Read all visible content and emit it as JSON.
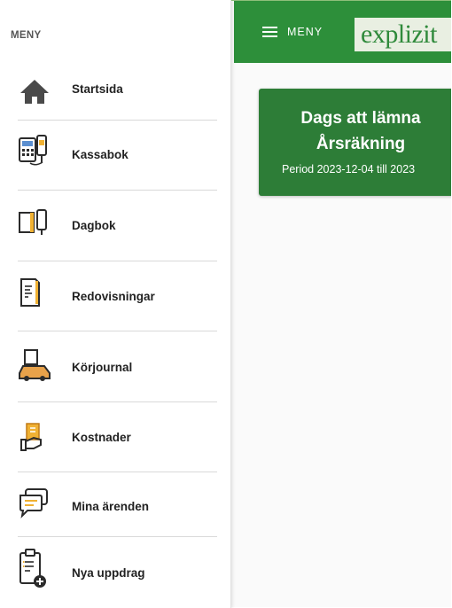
{
  "appbar": {
    "menu_label": "MENY",
    "logo": "explizit",
    "color": "#2d8f3a"
  },
  "card": {
    "line1": "Dags att lämna",
    "line2": "Årsräkning",
    "period": "Period 2023-12-04 till 2023",
    "color": "#2d7d37"
  },
  "drawer": {
    "title": "MENY",
    "items": [
      {
        "label": "Startsida",
        "icon": "home-icon"
      },
      {
        "label": "Kassabok",
        "icon": "calculator-icon"
      },
      {
        "label": "Dagbok",
        "icon": "notebook-icon"
      },
      {
        "label": "Redovisningar",
        "icon": "document-icon"
      },
      {
        "label": "Körjournal",
        "icon": "car-icon"
      },
      {
        "label": "Kostnader",
        "icon": "receipt-hand-icon"
      },
      {
        "label": "Mina ärenden",
        "icon": "chat-icon"
      },
      {
        "label": "Nya uppdrag",
        "icon": "clipboard-add-icon"
      }
    ]
  }
}
